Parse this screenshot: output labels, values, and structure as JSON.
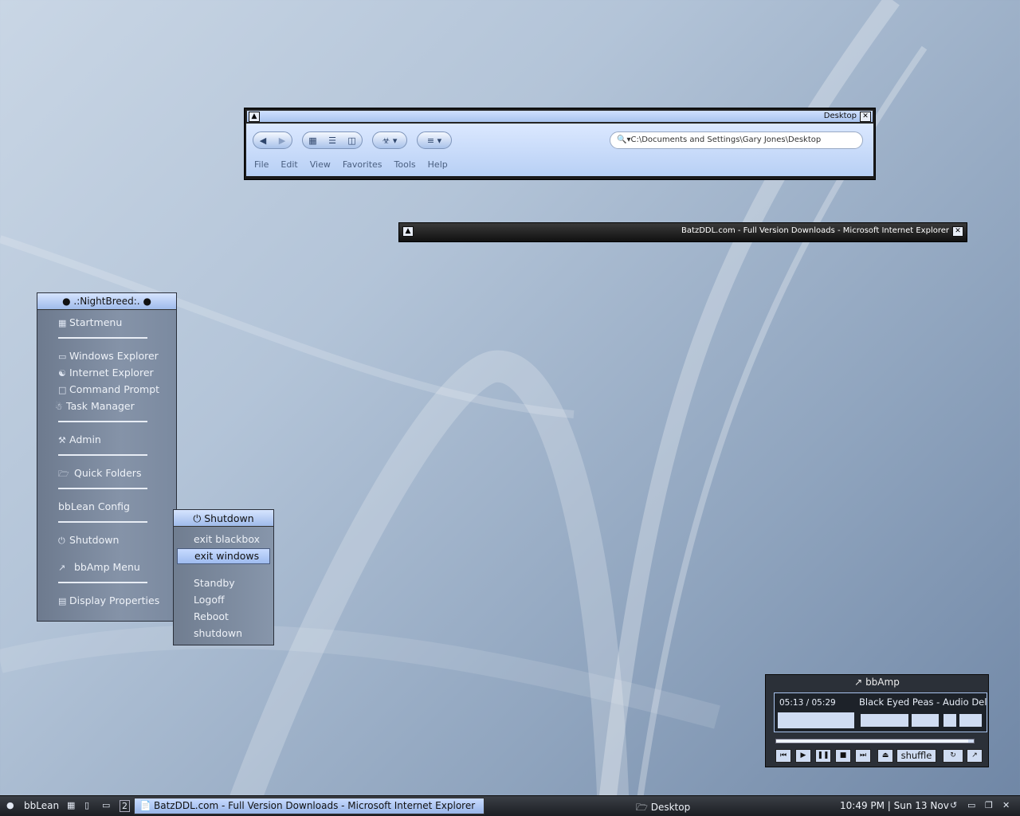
{
  "explorer": {
    "title": "Desktop",
    "address": "C:\\Documents and Settings\\Gary Jones\\Desktop",
    "menu": [
      "File",
      "Edit",
      "View",
      "Favorites",
      "Tools",
      "Help"
    ]
  },
  "ie_window": {
    "title": "BatzDDL.com - Full Version Downloads - Microsoft Internet Explorer"
  },
  "startmenu": {
    "title": ".:NightBreed:.",
    "items": {
      "startmenu": "Startmenu",
      "windows_explorer": "Windows Explorer",
      "internet_explorer": "Internet Explorer",
      "command_prompt": "Command Prompt",
      "task_manager": "Task Manager",
      "admin": "Admin",
      "quick_folders": "Quick Folders",
      "bblean_config": "bbLean Config",
      "shutdown": "Shutdown",
      "bbamp_menu": "bbAmp Menu",
      "display_properties": "Display Properties"
    }
  },
  "submenu": {
    "title": "Shutdown",
    "items": [
      "exit blackbox",
      "exit windows",
      "Standby",
      "Logoff",
      "Reboot",
      "shutdown"
    ]
  },
  "bbamp": {
    "title": "bbAmp",
    "time": "05:13 / 05:29",
    "track": "Black Eyed Peas - Audio Del",
    "progress": 0.97,
    "shuffle": "shuffle"
  },
  "taskbar": {
    "start_label": "bbLean",
    "workspace": "2",
    "active_task": "BatzDDL.com - Full Version Downloads - Microsoft Internet Explorer",
    "task_desktop": "Desktop",
    "clock": "10:49 PM | Sun 13 Nov"
  },
  "colors": {
    "accent": "#a9c4ee",
    "menu_bg": "#7b8aa0",
    "bar_dark": "#1b1e23"
  }
}
